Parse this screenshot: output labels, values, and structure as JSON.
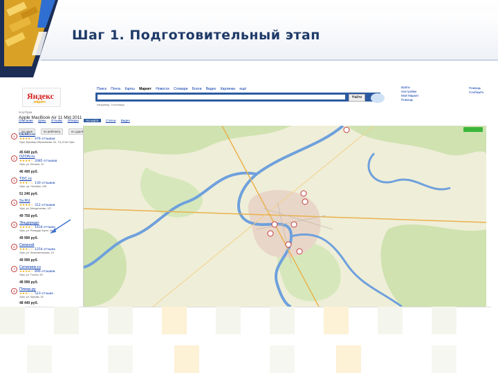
{
  "slide": {
    "title": "Шаг 1. Подготовительный этап"
  },
  "yandex": {
    "logo": "Яндекс",
    "service": "маркет",
    "tabs": [
      "Поиск",
      "Почта",
      "Карты",
      "Маркет",
      "Новости",
      "Словари",
      "Блоги",
      "Видео",
      "Картинки",
      "ещё"
    ],
    "active_tab": 3,
    "search_button": "Найти",
    "search_hint": "например, Гостиница",
    "account": [
      "Войти",
      "Настройки",
      "Мой Маркет",
      "Помощь"
    ],
    "help": [
      "Помощь",
      "Сообщить"
    ]
  },
  "product": {
    "section": "Ноутбуки",
    "name": "Apple MacBook Air 11 Mid 2011",
    "view_tabs": [
      "Описание",
      "Цены",
      "Отзывы",
      "Обзоры",
      "На карте",
      "Статьи",
      "Видео"
    ],
    "active_view": 4,
    "sort_tabs": [
      "по цене",
      "по рейтингу",
      "по удалённости"
    ]
  },
  "shops": [
    {
      "num": "1",
      "name": "DEMO.ru",
      "stars": "★★★★☆",
      "reviews": "476 отзывов",
      "address": "Уфа, Бульвар Ибрагимова, 54, ТЦ Огни Уфы",
      "price": "45 640 руб."
    },
    {
      "num": "2",
      "name": "OZON.ru",
      "stars": "★★★★☆",
      "reviews": "2085 отзывов",
      "address": "Уфа, ул. Ленина, 12",
      "price": "46 490 руб."
    },
    {
      "num": "3",
      "name": "TDC.ru",
      "stars": "★★★☆☆",
      "reviews": "130 отзывов",
      "address": "Уфа, пр. Октября, 105",
      "price": "51 240 руб."
    },
    {
      "num": "4",
      "name": "Sv.RU",
      "stars": "★★★★☆",
      "reviews": "312 отзывов",
      "address": "Уфа, ул. Менделеева, 137",
      "price": "49 750 руб."
    },
    {
      "num": "5",
      "name": "Эльдорадо",
      "stars": "★★★★☆",
      "reviews": "1434 отзыва",
      "address": "Уфа, ул. Рихарда Зорге, 69",
      "price": "49 990 руб."
    },
    {
      "num": "6",
      "name": "Связной",
      "stars": "★★★☆☆",
      "reviews": "1254 отзыва",
      "address": "Уфа, ул. Комсомольская, 15",
      "price": "49 990 руб."
    },
    {
      "num": "7",
      "name": "Ситилинк.ru",
      "stars": "★★★★☆",
      "reviews": "896 отзывов",
      "address": "Уфа, ул. Гоголя, 60",
      "price": "48 990 руб."
    },
    {
      "num": "8",
      "name": "Плеер.ру",
      "stars": "★★★☆☆",
      "reviews": "523 отзыва",
      "address": "Уфа, ул. Кирова, 52",
      "price": "48 440 руб."
    }
  ],
  "map": {
    "city": "Уфа"
  },
  "colors": {
    "brand": "#d61b1b",
    "link": "#0033aa",
    "search_bar": "#2b5aa0",
    "title": "#1f3a68",
    "river": "#6ea0dc"
  }
}
